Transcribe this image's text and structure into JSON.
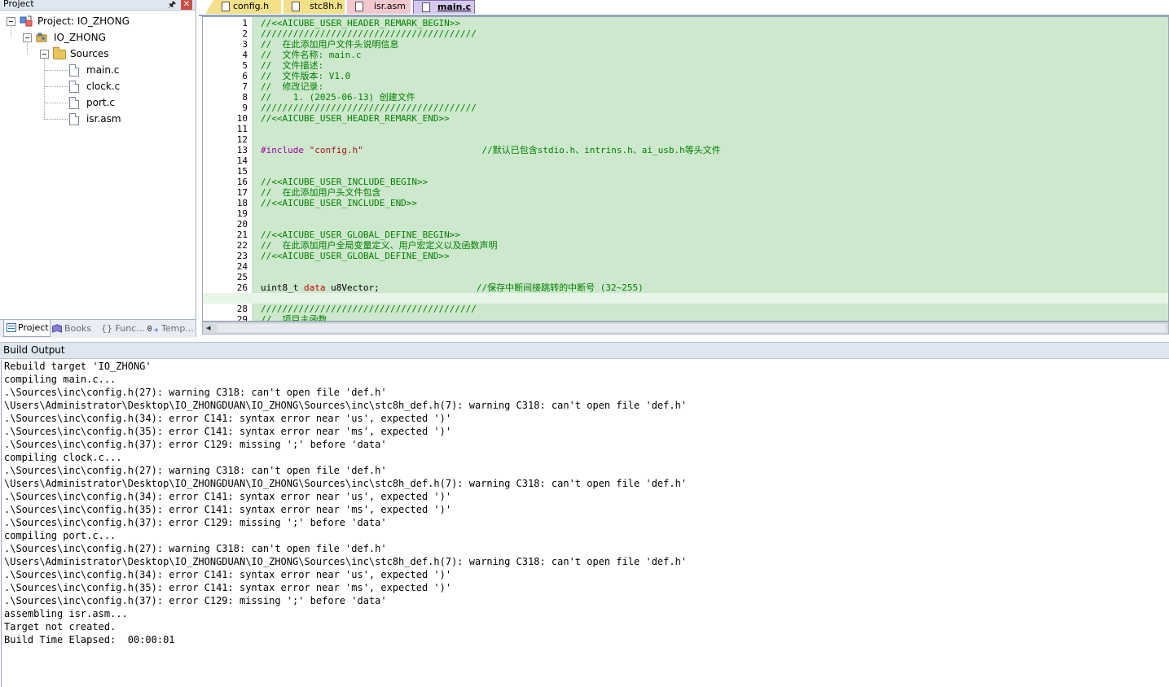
{
  "project_panel": {
    "title": "Project",
    "tree": {
      "project_label": "Project: IO_ZHONG",
      "target_label": "IO_ZHONG",
      "group_label": "Sources",
      "files": [
        "main.c",
        "clock.c",
        "port.c",
        "isr.asm"
      ]
    },
    "tabs": [
      {
        "label": "Project",
        "icon": "project-tab-icon"
      },
      {
        "label": "Books",
        "icon": "books-icon"
      },
      {
        "label": "{} Func...",
        "icon": "functions-icon"
      },
      {
        "label": "Temp...",
        "icon": "templates-icon"
      }
    ]
  },
  "editor": {
    "tabs": [
      {
        "label": "config.h",
        "color": "#f3e08a"
      },
      {
        "label": "stc8h.h",
        "color": "#f3e08a"
      },
      {
        "label": "isr.asm",
        "color": "#f2c8cf"
      },
      {
        "label": "main.c",
        "color": "#d7c8f0",
        "active": true
      }
    ],
    "lines": [
      {
        "n": "1",
        "tokens": [
          {
            "t": "comment",
            "v": "//<<AICUBE_USER_HEADER_REMARK_BEGIN>>"
          }
        ]
      },
      {
        "n": "2",
        "tokens": [
          {
            "t": "comment",
            "v": "////////////////////////////////////////"
          }
        ]
      },
      {
        "n": "3",
        "tokens": [
          {
            "t": "comment",
            "v": "//  在此添加用户文件头说明信息"
          }
        ]
      },
      {
        "n": "4",
        "tokens": [
          {
            "t": "comment",
            "v": "//  文件名称: main.c"
          }
        ]
      },
      {
        "n": "5",
        "tokens": [
          {
            "t": "comment",
            "v": "//  文件描述:"
          }
        ]
      },
      {
        "n": "6",
        "tokens": [
          {
            "t": "comment",
            "v": "//  文件版本: V1.0"
          }
        ]
      },
      {
        "n": "7",
        "tokens": [
          {
            "t": "comment",
            "v": "//  修改记录:"
          }
        ]
      },
      {
        "n": "8",
        "tokens": [
          {
            "t": "comment",
            "v": "//    1. (2025-06-13) 创建文件"
          }
        ]
      },
      {
        "n": "9",
        "tokens": [
          {
            "t": "comment",
            "v": "////////////////////////////////////////"
          }
        ]
      },
      {
        "n": "10",
        "tokens": [
          {
            "t": "comment",
            "v": "//<<AICUBE_USER_HEADER_REMARK_END>>"
          }
        ]
      },
      {
        "n": "11",
        "tokens": []
      },
      {
        "n": "12",
        "tokens": []
      },
      {
        "n": "13",
        "tokens": [
          {
            "t": "pre",
            "v": "#include "
          },
          {
            "t": "str",
            "v": "\"config.h\""
          },
          {
            "t": "plain",
            "v": "                      "
          },
          {
            "t": "comment",
            "v": "//默认已包含stdio.h、intrins.h、ai_usb.h等头文件"
          }
        ]
      },
      {
        "n": "14",
        "tokens": []
      },
      {
        "n": "15",
        "tokens": []
      },
      {
        "n": "16",
        "tokens": [
          {
            "t": "comment",
            "v": "//<<AICUBE_USER_INCLUDE_BEGIN>>"
          }
        ]
      },
      {
        "n": "17",
        "tokens": [
          {
            "t": "comment",
            "v": "//  在此添加用户头文件包含"
          }
        ]
      },
      {
        "n": "18",
        "tokens": [
          {
            "t": "comment",
            "v": "//<<AICUBE_USER_INCLUDE_END>>"
          }
        ]
      },
      {
        "n": "19",
        "tokens": []
      },
      {
        "n": "20",
        "tokens": []
      },
      {
        "n": "21",
        "tokens": [
          {
            "t": "comment",
            "v": "//<<AICUBE_USER_GLOBAL_DEFINE_BEGIN>>"
          }
        ]
      },
      {
        "n": "22",
        "tokens": [
          {
            "t": "comment",
            "v": "//  在此添加用户全局变量定义、用户宏定义以及函数声明"
          }
        ]
      },
      {
        "n": "23",
        "tokens": [
          {
            "t": "comment",
            "v": "//<<AICUBE_USER_GLOBAL_DEFINE_END>>"
          }
        ]
      },
      {
        "n": "24",
        "tokens": []
      },
      {
        "n": "25",
        "tokens": []
      },
      {
        "n": "26",
        "tokens": [
          {
            "t": "plain",
            "v": "uint8_t "
          },
          {
            "t": "kw",
            "v": "data"
          },
          {
            "t": "plain",
            "v": " u8Vector;                  "
          },
          {
            "t": "comment",
            "v": "//保存中断间接跳转的中断号 (32~255)"
          }
        ]
      },
      {
        "n": "27",
        "tokens": [],
        "highlight": true
      },
      {
        "n": "28",
        "tokens": [
          {
            "t": "comment",
            "v": "////////////////////////////////////////"
          }
        ]
      },
      {
        "n": "29",
        "tokens": [
          {
            "t": "comment",
            "v": "//  项目主函数"
          }
        ]
      }
    ]
  },
  "build_output": {
    "title": "Build Output",
    "lines": [
      "Rebuild target 'IO_ZHONG'",
      "compiling main.c...",
      ".\\Sources\\inc\\config.h(27): warning C318: can't open file 'def.h'",
      "\\Users\\Administrator\\Desktop\\IO_ZHONGDUAN\\IO_ZHONG\\Sources\\inc\\stc8h_def.h(7): warning C318: can't open file 'def.h'",
      ".\\Sources\\inc\\config.h(34): error C141: syntax error near 'us', expected ')'",
      ".\\Sources\\inc\\config.h(35): error C141: syntax error near 'ms', expected ')'",
      ".\\Sources\\inc\\config.h(37): error C129: missing ';' before 'data'",
      "compiling clock.c...",
      ".\\Sources\\inc\\config.h(27): warning C318: can't open file 'def.h'",
      "\\Users\\Administrator\\Desktop\\IO_ZHONGDUAN\\IO_ZHONG\\Sources\\inc\\stc8h_def.h(7): warning C318: can't open file 'def.h'",
      ".\\Sources\\inc\\config.h(34): error C141: syntax error near 'us', expected ')'",
      ".\\Sources\\inc\\config.h(35): error C141: syntax error near 'ms', expected ')'",
      ".\\Sources\\inc\\config.h(37): error C129: missing ';' before 'data'",
      "compiling port.c...",
      ".\\Sources\\inc\\config.h(27): warning C318: can't open file 'def.h'",
      "\\Users\\Administrator\\Desktop\\IO_ZHONGDUAN\\IO_ZHONG\\Sources\\inc\\stc8h_def.h(7): warning C318: can't open file 'def.h'",
      ".\\Sources\\inc\\config.h(34): error C141: syntax error near 'us', expected ')'",
      ".\\Sources\\inc\\config.h(35): error C141: syntax error near 'ms', expected ')'",
      ".\\Sources\\inc\\config.h(37): error C129: missing ';' before 'data'",
      "assembling isr.asm...",
      "Target not created.",
      "Build Time Elapsed:  00:00:01"
    ]
  },
  "colors": {
    "code_background": "#cde8cd",
    "current_line": "#e6f6e6",
    "comment": "#008000",
    "keyword": "#c00000",
    "preprocessor": "#a000a0",
    "string": "#a31515"
  }
}
